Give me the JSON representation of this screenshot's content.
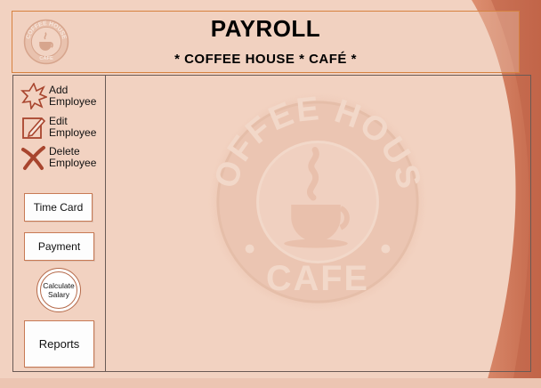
{
  "header": {
    "title": "PAYROLL",
    "subtitle": "* COFFEE HOUSE * CAFÉ *",
    "logo_icon": "coffee-house-cafe-logo"
  },
  "sidebar": {
    "add_employee": {
      "label": "Add\nEmployee",
      "icon": "starburst-icon"
    },
    "edit_employee": {
      "label": "Edit\nEmployee",
      "icon": "edit-pencil-icon"
    },
    "delete_employee": {
      "label": "Delete\nEmployee",
      "icon": "delete-x-icon"
    },
    "time_card": "Time Card",
    "payment": "Payment",
    "calculate_salary": "Calculate\nSalary",
    "reports": "Reports"
  },
  "watermark": {
    "icon": "coffee-house-cafe-logo",
    "text_top": "COFFEE HOUSE",
    "text_bottom": "CAFE"
  },
  "colors": {
    "background": "#f2d2c1",
    "accent": "#c8775a",
    "border": "#d6823f",
    "icon": "#a8452e"
  }
}
